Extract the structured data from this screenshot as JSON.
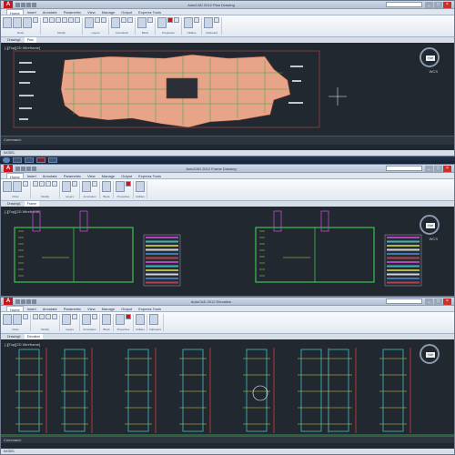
{
  "windows": [
    {
      "title": "AutoCAD 2012  Plan Drawing",
      "tabs": [
        "Home",
        "Insert",
        "Annotate",
        "Parametric",
        "View",
        "Manage",
        "Output",
        "Express Tools"
      ],
      "file_tabs": [
        "Drawing1",
        "Plan"
      ],
      "viewport_label": "[-][Top][2D Wireframe]",
      "command_prompt": "Command:",
      "status": "MODEL",
      "viewcube": "TOP",
      "wcs": "WCS"
    },
    {
      "title": "AutoCAD 2012  Frame Drawing",
      "tabs": [
        "Home",
        "Insert",
        "Annotate",
        "Parametric",
        "View",
        "Manage",
        "Output",
        "Express Tools"
      ],
      "file_tabs": [
        "Drawing1",
        "Frame"
      ],
      "viewport_label": "[-][Top][2D Wireframe]",
      "viewcube": "TOP",
      "wcs": "WCS"
    },
    {
      "title": "AutoCAD 2012  Elevation",
      "tabs": [
        "Home",
        "Insert",
        "Annotate",
        "Parametric",
        "View",
        "Manage",
        "Output",
        "Express Tools"
      ],
      "file_tabs": [
        "Drawing1",
        "Elevation"
      ],
      "viewport_label": "[-][Top][2D Wireframe]",
      "command_prompt": "Command:",
      "status": "MODEL",
      "viewcube": "TOP"
    }
  ],
  "ribbon_panels": [
    "Draw",
    "Modify",
    "Layers",
    "Annotation",
    "Block",
    "Properties",
    "Utilities",
    "Clipboard"
  ],
  "taskbar": {
    "clock": ""
  },
  "colors": {
    "accent": "#c8161d",
    "plan_fill": "#e8a488",
    "canvas": "#212830"
  }
}
